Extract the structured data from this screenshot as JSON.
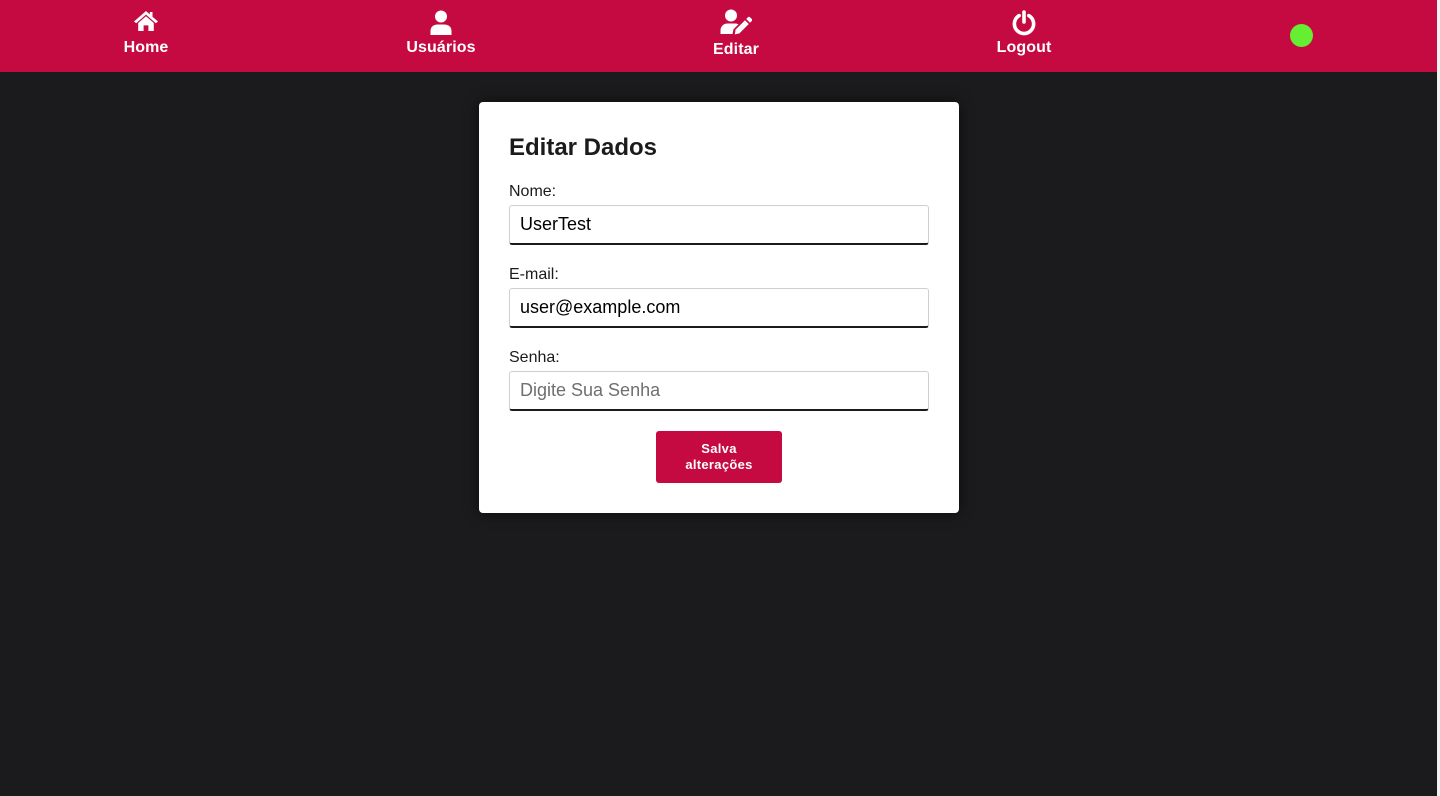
{
  "navbar": {
    "background": "#c40a41",
    "items": [
      {
        "label": "Home",
        "icon": "home-icon"
      },
      {
        "label": "Usuários",
        "icon": "user-icon"
      },
      {
        "label": "Editar",
        "icon": "user-edit-icon"
      },
      {
        "label": "Logout",
        "icon": "power-icon"
      }
    ],
    "status_color": "#66ee33"
  },
  "form": {
    "title": "Editar Dados",
    "fields": [
      {
        "label": "Nome:",
        "value": "UserTest",
        "placeholder": ""
      },
      {
        "label": "E-mail:",
        "value": "user@example.com",
        "placeholder": ""
      },
      {
        "label": "Senha:",
        "value": "",
        "placeholder": "Digite Sua Senha"
      }
    ],
    "submit_label": "Salva alterações",
    "accent": "#c40a41"
  }
}
